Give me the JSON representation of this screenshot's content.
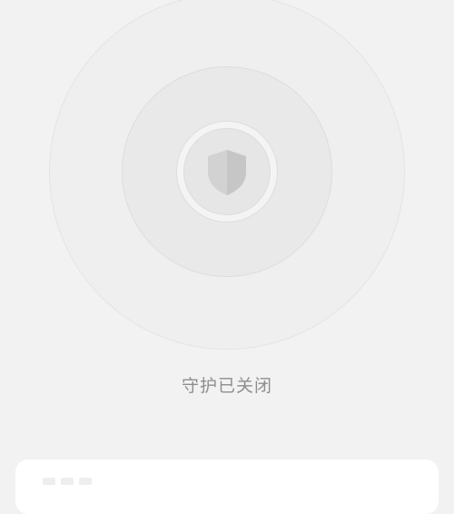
{
  "status": {
    "text": "守护已关闭"
  },
  "icons": {
    "center": "shield-icon"
  },
  "colors": {
    "background": "#f2f2f2",
    "status_text": "#8e8e8e",
    "shield": "#cfcfcf",
    "card": "#ffffff"
  }
}
